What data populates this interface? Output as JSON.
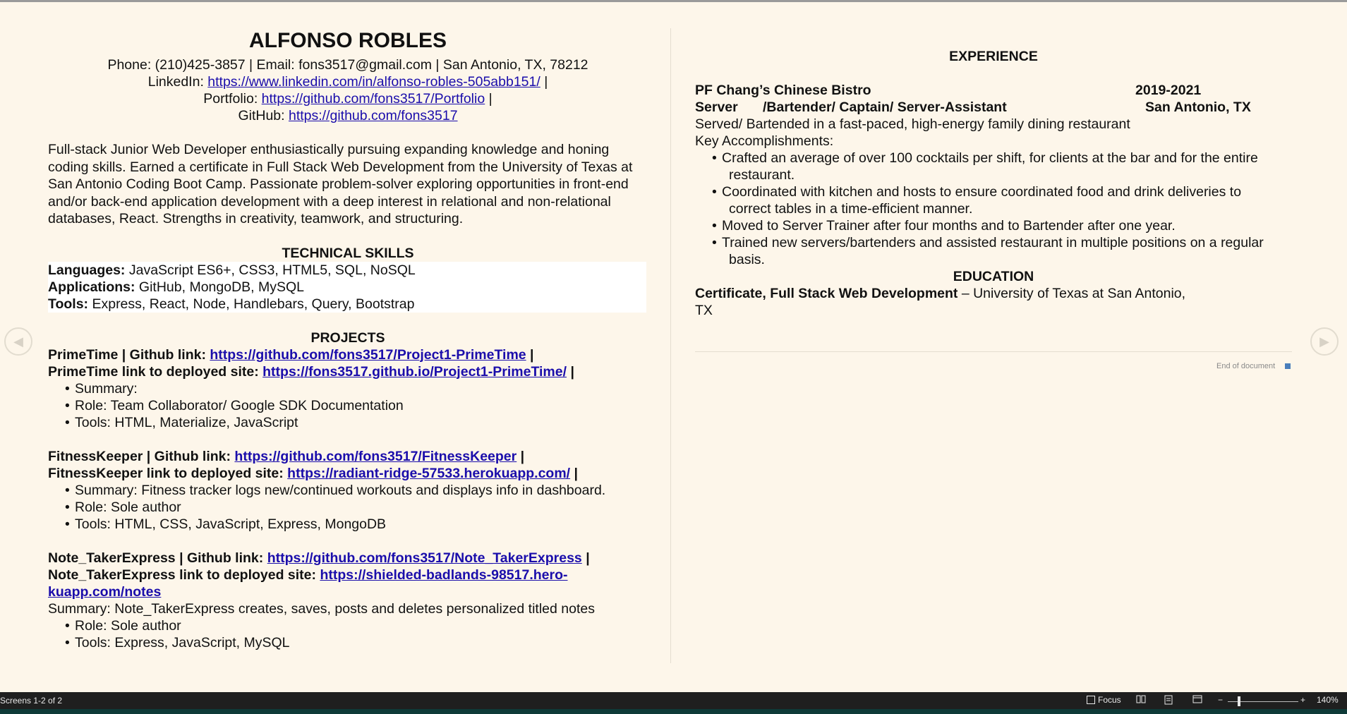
{
  "header": {
    "name": "ALFONSO ROBLES",
    "contact": "Phone: (210)425-3857 | Email: fons3517@gmail.com | San Antonio, TX, 78212",
    "linkedin_label": "LinkedIn: ",
    "linkedin_url": "https://www.linkedin.com/in/alfonso-robles-505abb151/",
    "portfolio_label": "Portfolio: ",
    "portfolio_url": "https://github.com/fons3517/Portfolio",
    "github_label": "GitHub: ",
    "github_url": "https://github.com/fons3517",
    "sep": " | "
  },
  "summary": "Full-stack Junior Web Developer enthusiastically pursuing expanding knowledge and honing coding skills. Earned a certificate in Full Stack Web Development from the University of Texas at San Antonio Coding Boot Camp. Passionate problem-solver exploring opportunities in front-end and/or back-end application development with a deep interest in relational and non-relational databases, React. Strengths in creativity, teamwork, and structuring.",
  "skills": {
    "heading": "TECHNICAL SKILLS",
    "languages_label": "Languages:",
    "languages": " JavaScript ES6+, CSS3, HTML5, SQL, NoSQL",
    "applications_label": "Applications:",
    "applications": " GitHub, MongoDB, MySQL",
    "tools_label": "Tools:",
    "tools": " Express, React, Node, Handlebars, Query, Bootstrap"
  },
  "projects": {
    "heading": "PROJECTS",
    "p1_github_label": "PrimeTime | Github link: ",
    "p1_github_url": "https://github.com/fons3517/Project1-PrimeTime",
    "p1_site_label": " PrimeTime link to deployed site: ",
    "p1_site_url": "https://fons3517.github.io/Project1-PrimeTime/",
    "p1_bullets": [
      "Summary:",
      "Role: Team Collaborator/ Google SDK Documentation",
      "Tools: HTML, Materialize, JavaScript"
    ],
    "p2_github_label": "FitnessKeeper | Github link: ",
    "p2_github_url": "https://github.com/fons3517/FitnessKeeper",
    "p2_site_label": "FitnessKeeper link to deployed site: ",
    "p2_site_url": "https://radiant-ridge-57533.herokuapp.com/",
    "p2_bullets": [
      "Summary: Fitness tracker logs new/continued workouts and displays info in dashboard.",
      "Role: Sole author",
      "Tools: HTML, CSS, JavaScript, Express, MongoDB"
    ],
    "p3_github_label": "Note_TakerExpress | Github link: ",
    "p3_github_url": "https://github.com/fons3517/Note_TakerExpress",
    "p3_site_label": "Note_TakerExpress link to deployed site: ",
    "p3_site_url_1": "https://shielded-badlands-98517.hero-",
    "p3_site_url_2": "kuapp.com/notes",
    "p3_summary": "Summary: Note_TakerExpress creates, saves, posts and deletes personalized titled notes",
    "p3_bullets": [
      "Role: Sole author",
      "Tools: Express, JavaScript, MySQL"
    ]
  },
  "experience": {
    "heading": "EXPERIENCE",
    "company": "PF Chang’s Chinese Bistro",
    "years": "2019-2021",
    "title_a": "Server",
    "title_b": "/Bartender/ Captain/ Server-Assistant",
    "location": "San Antonio, TX",
    "description": "Served/ Bartended in a fast-paced, high-energy family dining restaurant",
    "accomplishments_label": "Key Accomplishments:",
    "bullets": [
      {
        "a": "Crafted an average of over 100 cocktails per shift, for clients at the bar and for the entire",
        "b": "restaurant."
      },
      {
        "a": "Coordinated with kitchen and hosts to ensure coordinated food and drink deliveries to",
        "b": "correct tables in a time-efficient manner."
      },
      {
        "a": "Moved to Server Trainer after four months and to Bartender after one year.",
        "b": ""
      },
      {
        "a": "Trained new servers/bartenders and assisted restaurant in multiple positions on a regular",
        "b": "basis."
      }
    ]
  },
  "education": {
    "heading": "EDUCATION",
    "degree": "Certificate, Full Stack Web Development",
    "school": " – University of Texas at San Antonio,",
    "state": "TX"
  },
  "end_of_document": "End of document",
  "statusbar": {
    "screens": "Screens 1-2 of 2",
    "focus": "Focus",
    "zoom": "140%",
    "minus": "−",
    "plus": "+"
  },
  "colors": {
    "link": "#1a0dab",
    "page_bg": "#fdf6ea",
    "status_bg": "#1f1f1f",
    "end_marker": "#4a7ebb"
  }
}
